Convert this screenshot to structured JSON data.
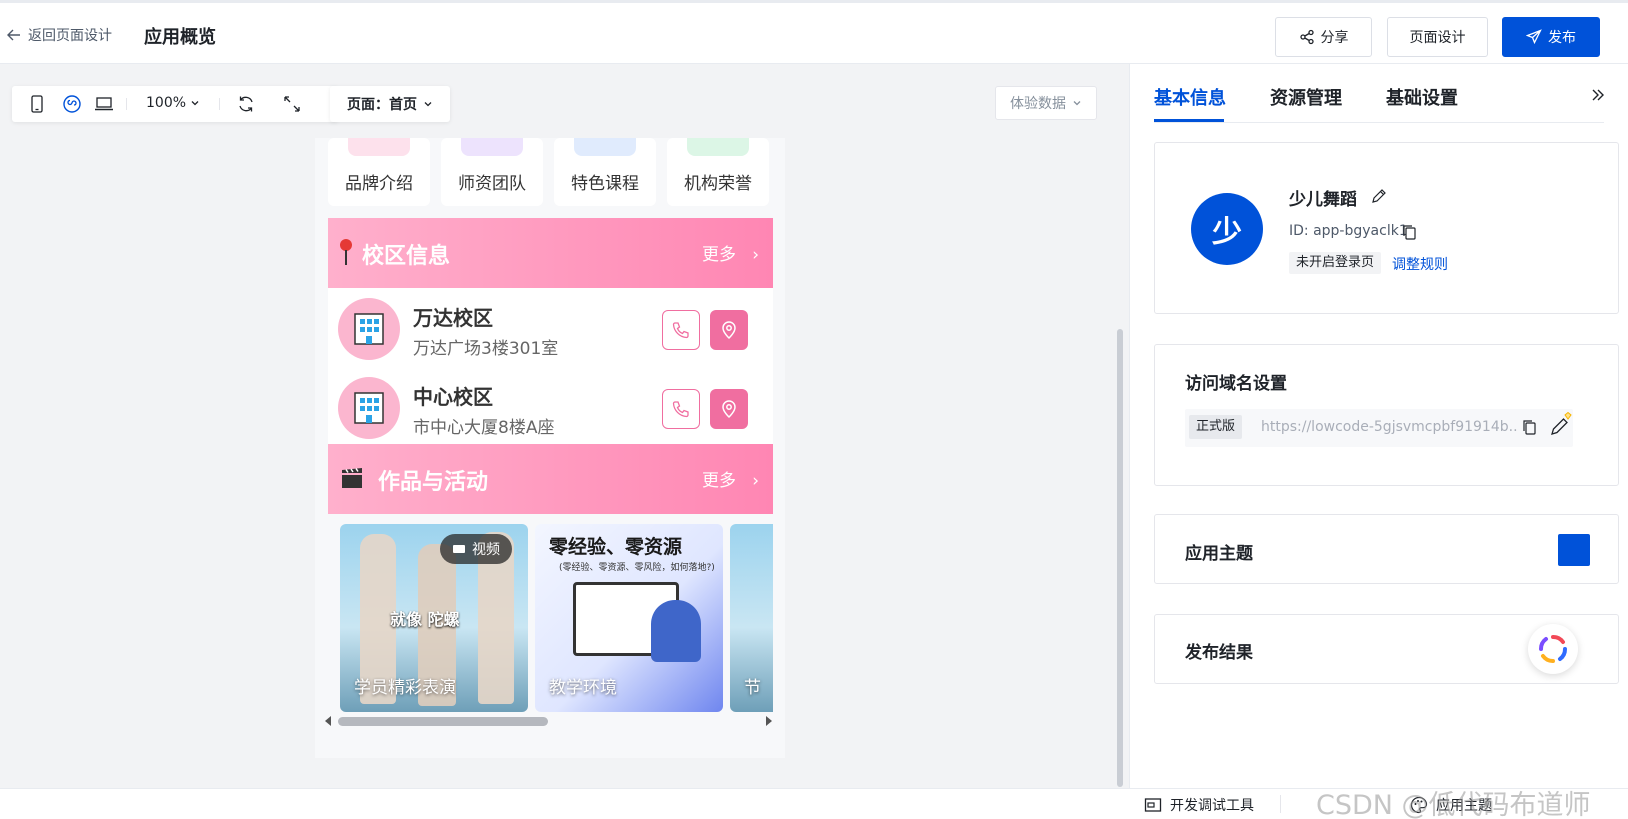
{
  "header": {
    "back_label": "返回页面设计",
    "title": "应用概览",
    "share_label": "分享",
    "design_label": "页面设计",
    "publish_label": "发布"
  },
  "toolbar": {
    "zoom": "100%",
    "page_label": "页面：首页",
    "experience_label": "体验数据"
  },
  "preview": {
    "nav_items": [
      {
        "label": "品牌介绍"
      },
      {
        "label": "师资团队"
      },
      {
        "label": "特色课程"
      },
      {
        "label": "机构荣誉"
      }
    ],
    "campus_section": {
      "title": "校区信息",
      "more": "更多"
    },
    "campuses": [
      {
        "name": "万达校区",
        "address": "万达广场3楼301室"
      },
      {
        "name": "中心校区",
        "address": "市中心大厦8楼A座"
      }
    ],
    "works_section": {
      "title": "作品与活动",
      "more": "更多"
    },
    "gallery": [
      {
        "label": "学员精彩表演",
        "badge": "视频",
        "overlay_text": "就像 陀螺"
      },
      {
        "label": "教学环境",
        "headline": "零经验、零资源",
        "subline": "(零经验、零资源、零风险，如何落地?)"
      },
      {
        "label": "节"
      }
    ]
  },
  "sidebar": {
    "tabs": [
      {
        "label": "基本信息"
      },
      {
        "label": "资源管理"
      },
      {
        "label": "基础设置"
      }
    ],
    "app": {
      "avatar_char": "少",
      "name": "少儿舞蹈",
      "id_text": "ID: app-bgyaclk1",
      "login_status": "未开启登录页",
      "adjust_link": "调整规则"
    },
    "domain": {
      "title": "访问域名设置",
      "env_tag": "正式版",
      "url": "https://lowcode-5gjsvmcpbf91914b..."
    },
    "theme": {
      "title": "应用主题",
      "color": "#0052d9"
    },
    "publish_result": {
      "title": "发布结果"
    }
  },
  "footer": {
    "dev_tools": "开发调试工具",
    "app_theme": "应用主题",
    "watermark": "CSDN @低代码布道师"
  }
}
